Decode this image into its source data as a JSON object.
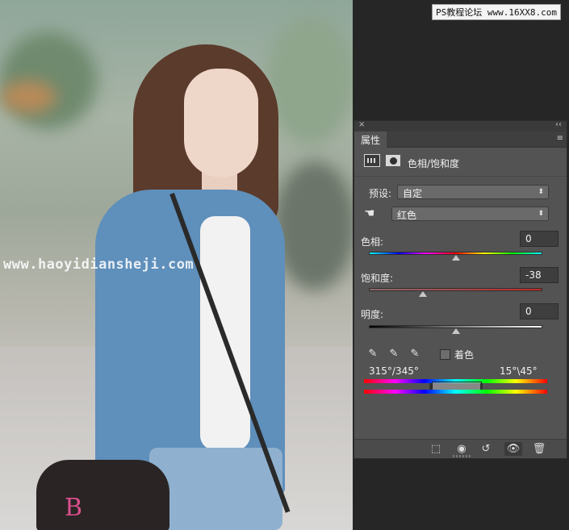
{
  "watermarks": {
    "left": "www.haoyidiansheji.com",
    "right": "PS教程论坛 www.16XX8.com"
  },
  "photo": {
    "bag_mark": "B"
  },
  "panel": {
    "close_glyph": "×",
    "collapse_glyph": "‹‹",
    "tab_label": "属性",
    "menu_glyph": "≡",
    "adjustment_title": "色相/饱和度",
    "preset_label": "预设:",
    "preset_value": "自定",
    "channel_value": "红色",
    "hand_glyph": "☚",
    "hue": {
      "label": "色相:",
      "value": "0",
      "position": 0.5
    },
    "saturation": {
      "label": "饱和度:",
      "value": "-38",
      "position": 0.31
    },
    "lightness": {
      "label": "明度:",
      "value": "0",
      "position": 0.5
    },
    "colorize_label": "着色",
    "colorize_checked": false,
    "range_left": "315°/345°",
    "range_right": "15°\\45°",
    "footer": {
      "clip_glyph": "⬚",
      "view_prev_glyph": "◉",
      "reset_glyph": "↺",
      "visibility_glyph": "👁",
      "delete_glyph": "🗑"
    }
  },
  "colors": {
    "panel_bg": "#535353",
    "workspace_bg": "#262626",
    "hue_track": "linear rainbow",
    "saturation_track": "#c02a2a",
    "lightness_track": "black-to-white"
  }
}
